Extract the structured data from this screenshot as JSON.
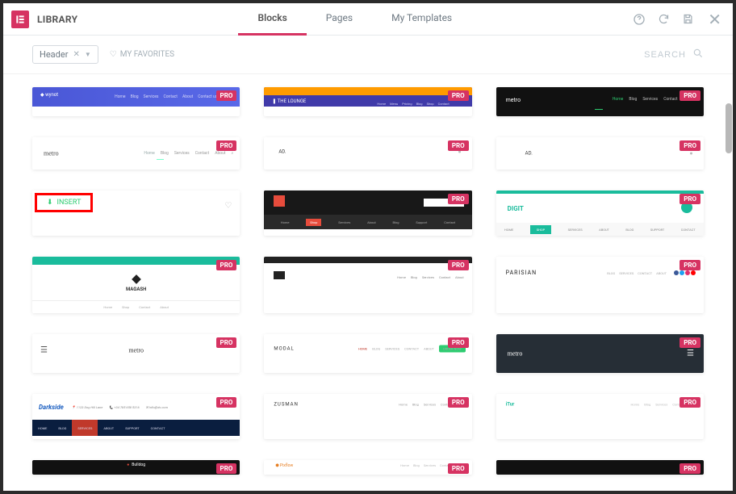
{
  "header": {
    "title": "LIBRARY",
    "tabs": [
      "Blocks",
      "Pages",
      "My Templates"
    ],
    "active_tab": "Blocks"
  },
  "toolbar": {
    "filter_label": "Header",
    "favorites_label": "MY FAVORITES",
    "search_placeholder": "SEARCH"
  },
  "badges": {
    "pro": "PRO"
  },
  "cards": {
    "insert_label": "INSERT",
    "t3_logo": "metro",
    "t4_logo": "metro",
    "t5_logo": "AD.",
    "t6_logo": "AD.",
    "t9_logo_a": "DIG",
    "t9_logo_b": "IT",
    "t10_logo": "MAGASH",
    "t12_logo": "PARISIAN",
    "t13_logo": "metro",
    "t14_logo": "MODAL",
    "t15_logo": "metro",
    "t16_logo": "Darkside",
    "t17_logo": "ZUSMAN",
    "t18_logo": "iTur",
    "t8_nav": [
      "Home",
      "Shop",
      "Services",
      "About",
      "Blog",
      "Support",
      "Contact"
    ],
    "t9_nav": [
      "HOME",
      "SHOP",
      "SERVICES",
      "ABOUT",
      "BLOG",
      "SUPPORT",
      "CONTACT"
    ],
    "nav_small": [
      "Home",
      "Blog",
      "Services",
      "Contact",
      "About"
    ]
  }
}
